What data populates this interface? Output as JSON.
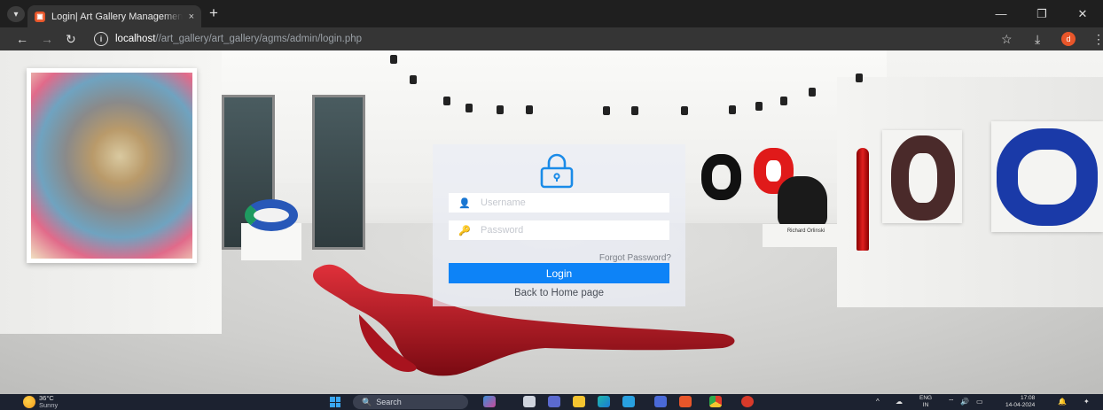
{
  "browser": {
    "tab_title": "Login| Art Gallery Management System",
    "tab_close": "×",
    "new_tab": "+",
    "url_host": "localhost",
    "url_path": "//art_gallery/art_gallery/agms/admin/login.php",
    "profile_initial": "d",
    "icons": [
      "tab-search-icon",
      "back-arrow-icon",
      "forward-arrow-icon",
      "reload-icon",
      "site-info-icon",
      "bookmark-star-icon",
      "download-icon",
      "kebab-menu-icon",
      "minimize-icon",
      "restore-icon",
      "close-icon"
    ]
  },
  "login": {
    "username_placeholder": "Username",
    "password_placeholder": "Password",
    "forgot_password": "Forgot Password?",
    "login_button": "Login",
    "back_home": "Back to Home page",
    "accent_color": "#0d83f7"
  },
  "gallery": {
    "plaque_artist": "Richard Orlinski"
  },
  "taskbar": {
    "temperature": "36°C",
    "weather_condition": "Sunny",
    "search_label": "Search",
    "language": "ENG",
    "region": "IN",
    "time": "17:08",
    "date": "14-04-2024"
  }
}
